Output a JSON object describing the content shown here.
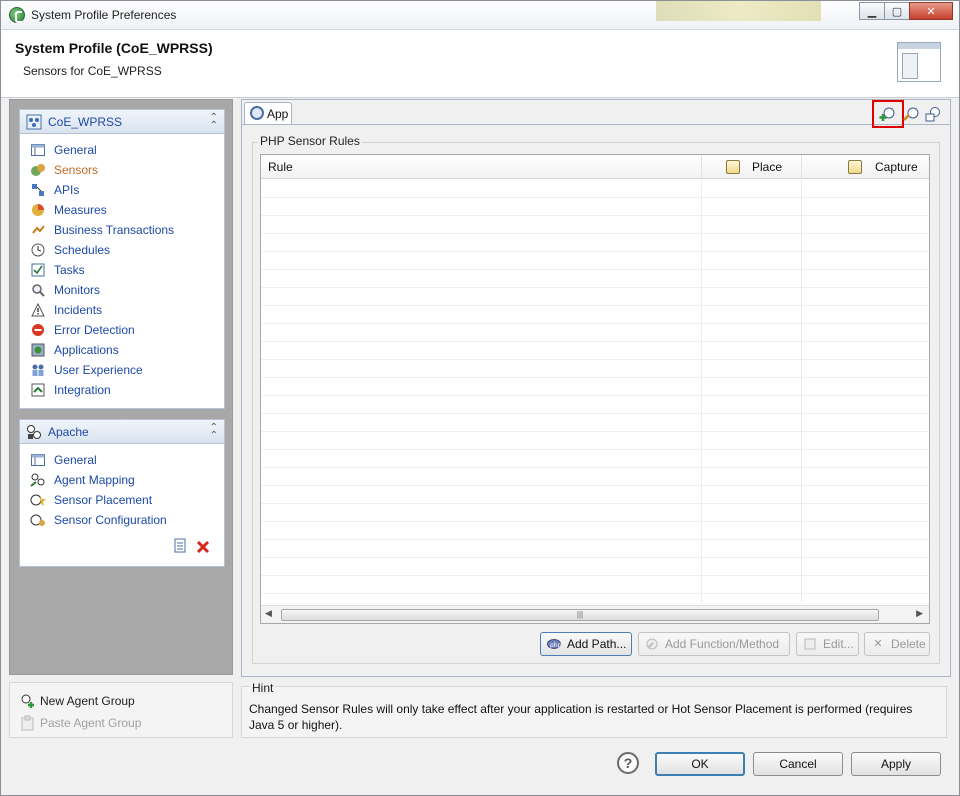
{
  "window": {
    "title": "System Profile Preferences"
  },
  "header": {
    "title": "System Profile (CoE_WPRSS)",
    "subtitle": "Sensors for CoE_WPRSS"
  },
  "sidebar": {
    "profile_section": {
      "title": "CoE_WPRSS",
      "items": [
        {
          "label": "General",
          "icon": "general-icon"
        },
        {
          "label": "Sensors",
          "icon": "sensors-icon",
          "active": true
        },
        {
          "label": "APIs",
          "icon": "apis-icon"
        },
        {
          "label": "Measures",
          "icon": "measures-icon"
        },
        {
          "label": "Business Transactions",
          "icon": "business-transactions-icon"
        },
        {
          "label": "Schedules",
          "icon": "schedules-icon"
        },
        {
          "label": "Tasks",
          "icon": "tasks-icon"
        },
        {
          "label": "Monitors",
          "icon": "monitors-icon"
        },
        {
          "label": "Incidents",
          "icon": "incidents-icon"
        },
        {
          "label": "Error Detection",
          "icon": "error-detection-icon"
        },
        {
          "label": "Applications",
          "icon": "applications-icon"
        },
        {
          "label": "User Experience",
          "icon": "user-experience-icon"
        },
        {
          "label": "Integration",
          "icon": "integration-icon"
        }
      ]
    },
    "agent_section": {
      "title": "Apache",
      "items": [
        {
          "label": "General",
          "icon": "general-icon"
        },
        {
          "label": "Agent Mapping",
          "icon": "agent-mapping-icon"
        },
        {
          "label": "Sensor Placement",
          "icon": "sensor-placement-icon"
        },
        {
          "label": "Sensor Configuration",
          "icon": "sensor-configuration-icon"
        }
      ]
    },
    "bottom": {
      "new_agent_group": "New Agent Group",
      "paste_agent_group": "Paste Agent Group"
    }
  },
  "main": {
    "tab": {
      "label": "App"
    },
    "group_title": "PHP Sensor Rules",
    "table": {
      "columns": [
        "Rule",
        "Place",
        "Capture"
      ],
      "rows": []
    },
    "buttons": {
      "add_path": "Add Path...",
      "add_function": "Add Function/Method",
      "edit": "Edit...",
      "delete": "Delete"
    }
  },
  "hint": {
    "title": "Hint",
    "text": "Changed Sensor Rules will only take effect after your application is restarted or Hot Sensor Placement is performed (requires Java 5 or higher)."
  },
  "footer": {
    "ok": "OK",
    "cancel": "Cancel",
    "apply": "Apply"
  },
  "colors": {
    "link": "#1c49a8",
    "active": "#c06a2a",
    "highlight": "#e00000"
  }
}
